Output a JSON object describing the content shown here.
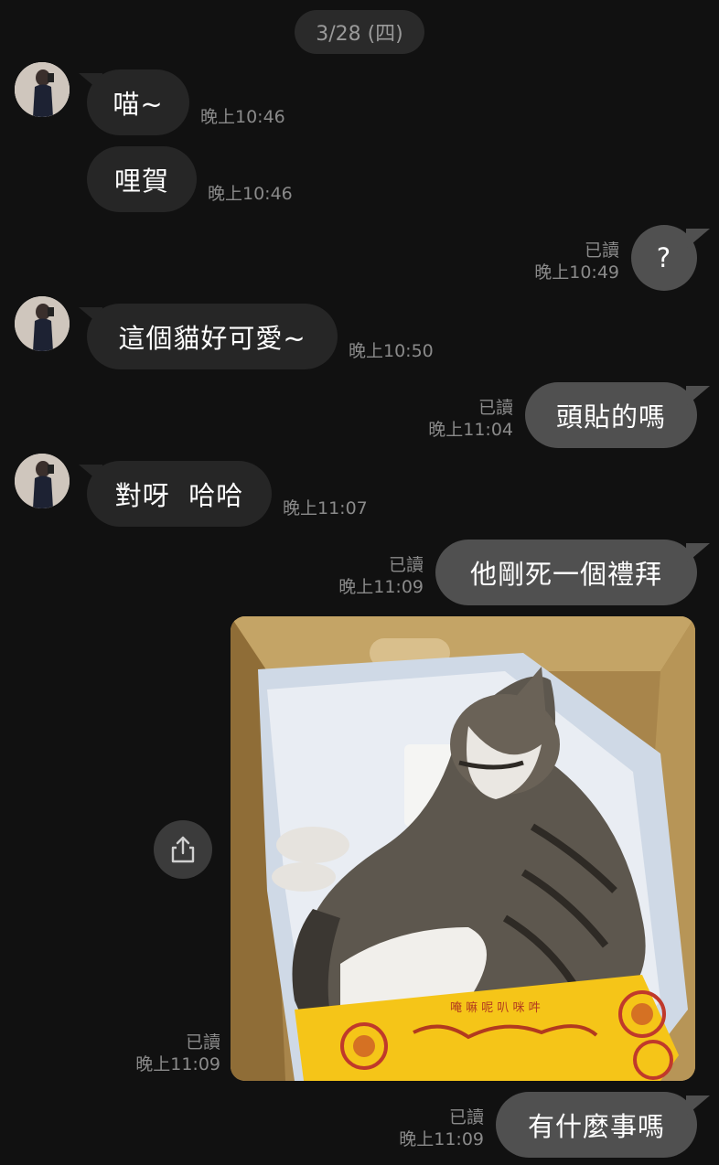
{
  "date_separator": "3/28 (四)",
  "messages": [
    {
      "side": "in",
      "text": "喵~",
      "time": "晚上10:46",
      "read": ""
    },
    {
      "side": "in",
      "text": "哩賀",
      "time": "晚上10:46",
      "read": ""
    },
    {
      "side": "out",
      "text": "?",
      "time": "晚上10:49",
      "read": "已讀"
    },
    {
      "side": "in",
      "text": "這個貓好可愛~",
      "time": "晚上10:50",
      "read": ""
    },
    {
      "side": "out",
      "text": "頭貼的嗎",
      "time": "晚上11:04",
      "read": "已讀"
    },
    {
      "side": "in",
      "text": "對呀  哈哈",
      "time": "晚上11:07",
      "read": ""
    },
    {
      "side": "out",
      "text": "他剛死一個禮拜",
      "time": "晚上11:09",
      "read": "已讀"
    },
    {
      "side": "out",
      "type": "image",
      "image_desc": "cat-in-box-photo",
      "time": "晚上11:09",
      "read": "已讀"
    },
    {
      "side": "out",
      "text": "有什麼事嗎",
      "time": "晚上11:09",
      "read": "已讀"
    }
  ],
  "icons": {
    "share": "share-icon",
    "avatar": "contact-avatar"
  },
  "photo_talisman": {
    "lines": [
      "唵 嘛 呢 叭 咪 吽"
    ],
    "color": "#f5c518"
  },
  "colors": {
    "background": "#111111",
    "bubble_in": "#262626",
    "bubble_out": "#505050",
    "meta_text": "#8a8a8a"
  }
}
